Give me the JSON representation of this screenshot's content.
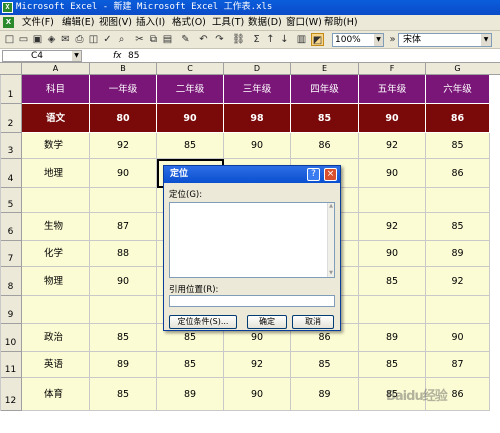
{
  "window": {
    "title": "Microsoft Excel - 新建 Microsoft Excel 工作表.xls"
  },
  "menu": [
    "文件(F)",
    "编辑(E)",
    "视图(V)",
    "插入(I)",
    "格式(O)",
    "工具(T)",
    "数据(D)",
    "窗口(W)",
    "帮助(H)"
  ],
  "toolbar": {
    "zoom": "100%",
    "font": "宋体",
    "sigma": "Σ"
  },
  "formula_bar": {
    "name_box": "C4",
    "fx": "fx",
    "value": "85"
  },
  "columns": [
    "A",
    "B",
    "C",
    "D",
    "E",
    "F",
    "G"
  ],
  "rows": [
    "1",
    "2",
    "3",
    "4",
    "5",
    "6",
    "7",
    "8",
    "9",
    "10",
    "11",
    "12"
  ],
  "table": {
    "header": [
      "科目",
      "一年级",
      "二年级",
      "三年级",
      "四年级",
      "五年级",
      "六年级"
    ],
    "rows": [
      [
        "语文",
        "80",
        "90",
        "98",
        "85",
        "90",
        "86"
      ],
      [
        "数学",
        "92",
        "85",
        "90",
        "86",
        "92",
        "85"
      ],
      [
        "地理",
        "90",
        "",
        "",
        "",
        "90",
        "86"
      ],
      [
        "",
        "",
        "",
        "",
        "",
        "",
        ""
      ],
      [
        "生物",
        "87",
        "",
        "",
        "",
        "92",
        "85"
      ],
      [
        "化学",
        "88",
        "",
        "",
        "",
        "90",
        "89"
      ],
      [
        "物理",
        "90",
        "",
        "",
        "",
        "85",
        "92"
      ],
      [
        "",
        "",
        "",
        "",
        "",
        "",
        ""
      ],
      [
        "政治",
        "85",
        "85",
        "90",
        "86",
        "89",
        "90"
      ],
      [
        "英语",
        "89",
        "85",
        "92",
        "85",
        "85",
        "87"
      ],
      [
        "体育",
        "85",
        "89",
        "90",
        "89",
        "85",
        "86"
      ]
    ]
  },
  "dialog": {
    "title": "定位",
    "help": "?",
    "close": "×",
    "goto_label": "定位(G):",
    "ref_label": "引用位置(R):",
    "special_button": "定位条件(S)...",
    "ok_button": "确定",
    "cancel_button": "取消"
  },
  "watermark": "Baidu经验"
}
